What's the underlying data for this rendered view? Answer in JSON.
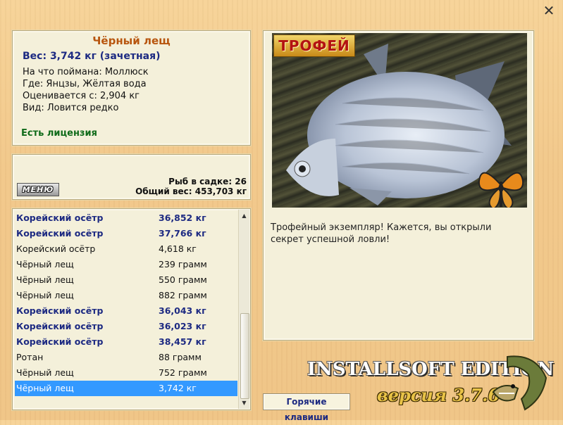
{
  "window": {
    "close_glyph": "✕"
  },
  "info": {
    "title": "Чёрный лещ",
    "weight": "Вес: 3,742 кг (зачетная)",
    "bait": "На что поймана: Моллюск",
    "place": "Где: Янцзы, Жёлтая вода",
    "valued": "Оценивается с: 2,904 кг",
    "species": "Вид: Ловится редко",
    "license": "Есть лицензия"
  },
  "cage": {
    "menu_label": "МЕНЮ",
    "count": "Рыб в садке: 26",
    "total": "Общий вес: 453,703 кг"
  },
  "catch_list": [
    {
      "name": "Корейский осётр",
      "weight": "36,852 кг",
      "bold": true
    },
    {
      "name": "Корейский осётр",
      "weight": "37,766 кг",
      "bold": true
    },
    {
      "name": "Корейский осётр",
      "weight": "4,618 кг",
      "bold": false
    },
    {
      "name": "Чёрный лещ",
      "weight": "239 грамм",
      "bold": false
    },
    {
      "name": "Чёрный лещ",
      "weight": "550 грамм",
      "bold": false
    },
    {
      "name": "Чёрный лещ",
      "weight": "882 грамм",
      "bold": false
    },
    {
      "name": "Корейский осётр",
      "weight": "36,043 кг",
      "bold": true
    },
    {
      "name": "Корейский осётр",
      "weight": "36,023 кг",
      "bold": true
    },
    {
      "name": "Корейский осётр",
      "weight": "38,457 кг",
      "bold": true
    },
    {
      "name": "Ротан",
      "weight": "88 грамм",
      "bold": false
    },
    {
      "name": "Чёрный лещ",
      "weight": "752 грамм",
      "bold": false
    },
    {
      "name": "Чёрный лещ",
      "weight": "3,742 кг",
      "bold": false,
      "selected": true
    }
  ],
  "photo": {
    "badge": "ТРОФЕЙ",
    "message": "Трофейный экземпляр! Кажется, вы открыли секрет успешной ловли!"
  },
  "footer": {
    "hotkeys": "Горячие клавиши",
    "edition": "INSTALLSOFT EDITION",
    "version": "версия 3.7.6"
  },
  "colors": {
    "accent_title": "#b8560f",
    "bold_row": "#1d2a82",
    "license": "#106b1a",
    "selection": "#3399ff"
  },
  "icons": [
    "close-icon",
    "butterfly-icon",
    "pike-logo-icon",
    "scroll-up-icon",
    "scroll-down-icon"
  ]
}
